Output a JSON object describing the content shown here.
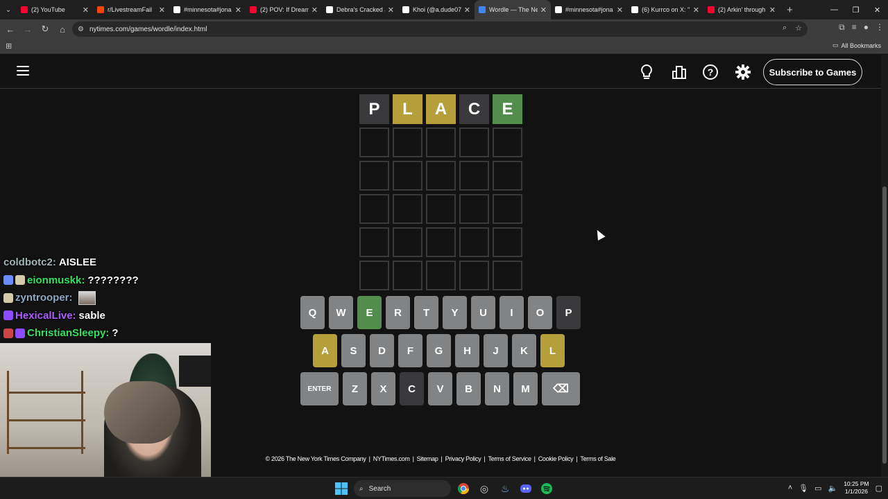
{
  "browser": {
    "tabs": [
      {
        "title": "(2) YouTube",
        "color": "#ff0033"
      },
      {
        "title": "r/LivestreamFail",
        "color": "#ff4500"
      },
      {
        "title": "#minnesota#jona",
        "color": "#ffffff"
      },
      {
        "title": "(2) POV: If Dream",
        "color": "#ff0033"
      },
      {
        "title": "Debra's Cracked J",
        "color": "#ffffff"
      },
      {
        "title": "Khoi (@a.dude07",
        "color": "#ffffff"
      },
      {
        "title": "Wordle — The Ne",
        "color": "#4285f4",
        "active": true
      },
      {
        "title": "#minnesota#jona",
        "color": "#ffffff"
      },
      {
        "title": "(6) Kurrco on X: \"",
        "color": "#ffffff"
      },
      {
        "title": "(2) Arkin' through",
        "color": "#ff0033"
      }
    ],
    "url": "nytimes.com/games/wordle/index.html",
    "bookmarks_label": "All Bookmarks"
  },
  "header": {
    "subscribe_label": "Subscribe to Games"
  },
  "board": {
    "rows": [
      [
        {
          "letter": "P",
          "state": "absent"
        },
        {
          "letter": "L",
          "state": "present"
        },
        {
          "letter": "A",
          "state": "present"
        },
        {
          "letter": "C",
          "state": "absent"
        },
        {
          "letter": "E",
          "state": "correct"
        }
      ],
      [
        {
          "letter": ""
        },
        {
          "letter": ""
        },
        {
          "letter": ""
        },
        {
          "letter": ""
        },
        {
          "letter": ""
        }
      ],
      [
        {
          "letter": ""
        },
        {
          "letter": ""
        },
        {
          "letter": ""
        },
        {
          "letter": ""
        },
        {
          "letter": ""
        }
      ],
      [
        {
          "letter": ""
        },
        {
          "letter": ""
        },
        {
          "letter": ""
        },
        {
          "letter": ""
        },
        {
          "letter": ""
        }
      ],
      [
        {
          "letter": ""
        },
        {
          "letter": ""
        },
        {
          "letter": ""
        },
        {
          "letter": ""
        },
        {
          "letter": ""
        }
      ],
      [
        {
          "letter": ""
        },
        {
          "letter": ""
        },
        {
          "letter": ""
        },
        {
          "letter": ""
        },
        {
          "letter": ""
        }
      ]
    ],
    "colors": {
      "correct": "#538d4e",
      "present": "#b59f3b",
      "absent": "#3a3a3c",
      "unused": "#818384"
    }
  },
  "keyboard": {
    "rows": [
      [
        {
          "key": "Q"
        },
        {
          "key": "W"
        },
        {
          "key": "E",
          "state": "correct"
        },
        {
          "key": "R"
        },
        {
          "key": "T"
        },
        {
          "key": "Y"
        },
        {
          "key": "U"
        },
        {
          "key": "I"
        },
        {
          "key": "O"
        },
        {
          "key": "P",
          "state": "absent"
        }
      ],
      [
        {
          "key": "A",
          "state": "present"
        },
        {
          "key": "S"
        },
        {
          "key": "D"
        },
        {
          "key": "F"
        },
        {
          "key": "G"
        },
        {
          "key": "H"
        },
        {
          "key": "J"
        },
        {
          "key": "K"
        },
        {
          "key": "L",
          "state": "present"
        }
      ],
      [
        {
          "key": "ENTER",
          "wide": true
        },
        {
          "key": "Z"
        },
        {
          "key": "X"
        },
        {
          "key": "C",
          "state": "absent"
        },
        {
          "key": "V"
        },
        {
          "key": "B"
        },
        {
          "key": "N"
        },
        {
          "key": "M"
        },
        {
          "key": "⌫",
          "wide": true,
          "icon": "backspace-icon"
        }
      ]
    ]
  },
  "footer": {
    "links": [
      "© 2026 The New York Times Company",
      "NYTimes.com",
      "Sitemap",
      "Privacy Policy",
      "Terms of Service",
      "Cookie Policy",
      "Terms of Sale"
    ]
  },
  "chat": [
    {
      "user": "coldbotc2:",
      "color": "#9fb6b6",
      "text": "AISLEE"
    },
    {
      "user": "eionmuskk:",
      "color": "#33e35c",
      "text": "????????",
      "badges": [
        "#6a8cff",
        "#d4c9a8"
      ]
    },
    {
      "user": "zyntrooper:",
      "color": "#8fa9c4",
      "text": "",
      "emote": true,
      "badges": [
        "#d4c9a8"
      ]
    },
    {
      "user": "HexicalLive:",
      "color": "#b05cff",
      "text": "sable",
      "badges": [
        "#8d4dff"
      ]
    },
    {
      "user": "ChristianSleepy:",
      "color": "#33e35c",
      "text": "?",
      "badges": [
        "#c44",
        "#8d4dff"
      ]
    }
  ],
  "taskbar": {
    "search_label": "Search",
    "time": "10:25 PM",
    "date": "1/1/2026"
  }
}
